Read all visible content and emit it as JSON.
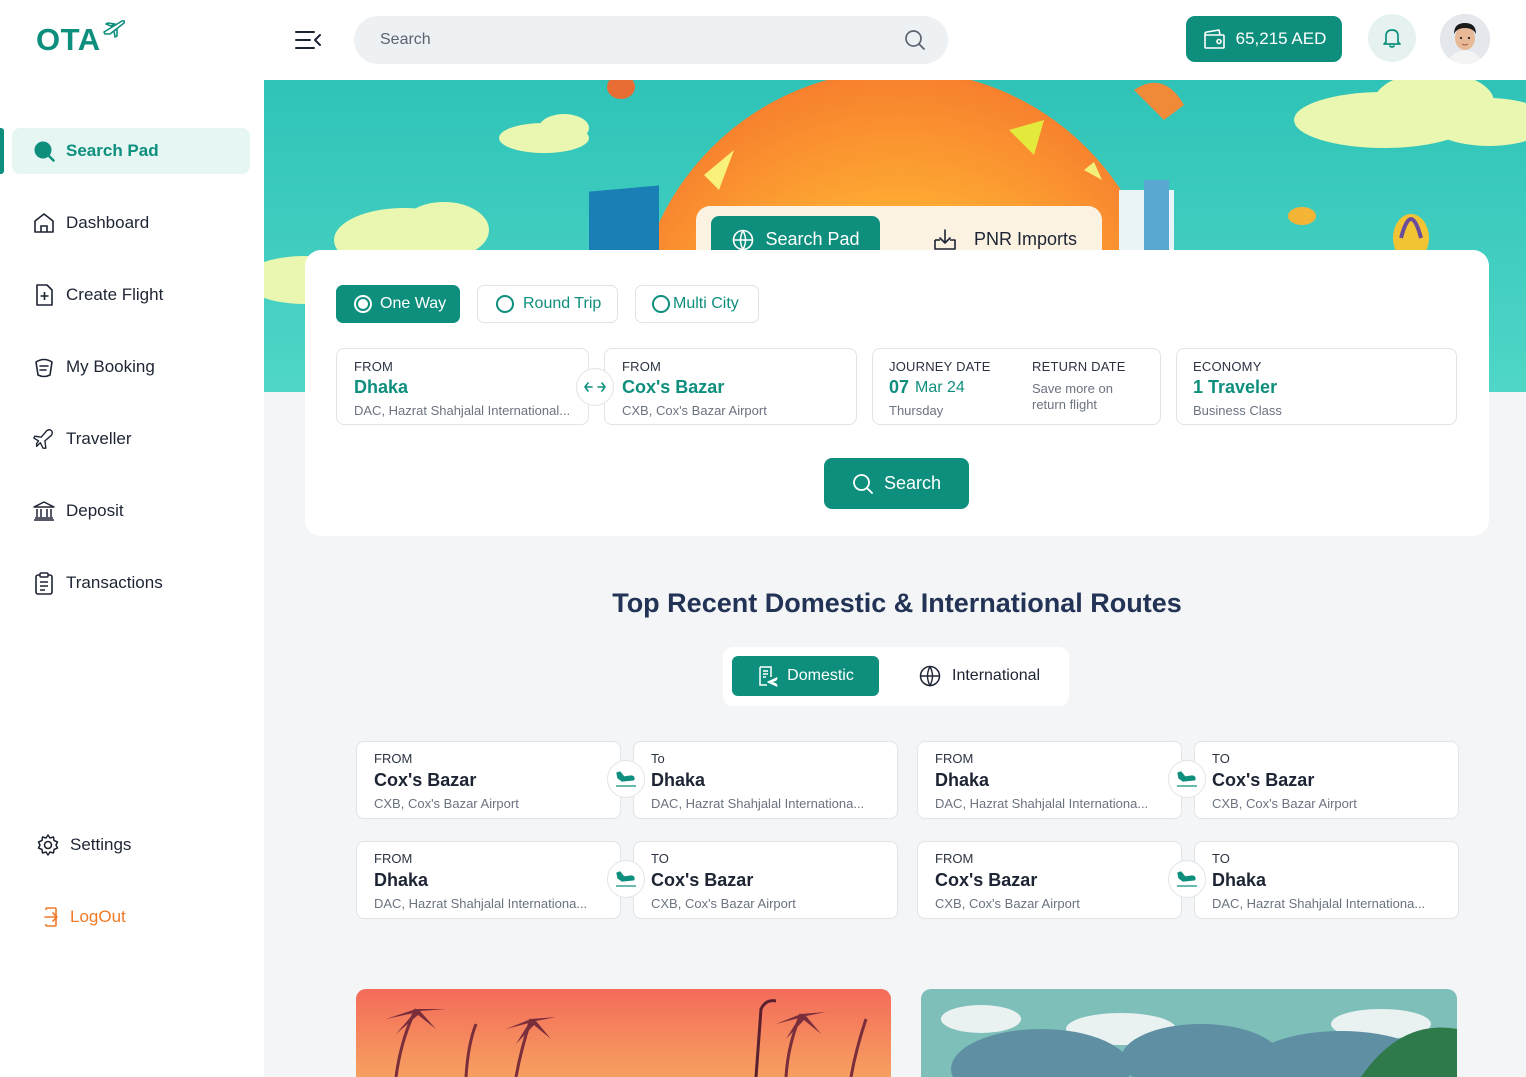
{
  "brand": {
    "logo_text": "OTA"
  },
  "sidebar": {
    "items": [
      {
        "label": "Search Pad",
        "icon": "search-pad-icon",
        "active": true
      },
      {
        "label": "Dashboard",
        "icon": "home-icon"
      },
      {
        "label": "Create Flight",
        "icon": "file-plus-icon"
      },
      {
        "label": "My Booking",
        "icon": "booking-icon"
      },
      {
        "label": "Traveller",
        "icon": "plane-icon"
      },
      {
        "label": "Deposit",
        "icon": "bank-icon"
      },
      {
        "label": "Transactions",
        "icon": "clipboard-icon"
      }
    ],
    "settings_label": "Settings",
    "logout_label": "LogOut"
  },
  "header": {
    "search_placeholder": "Search",
    "wallet_balance": "65,215 AED"
  },
  "search_panel": {
    "tabs": {
      "search_pad": "Search Pad",
      "pnr_imports": "PNR Imports"
    },
    "trip_types": {
      "one_way": "One Way",
      "round_trip": "Round Trip",
      "multi_city": "Multi City"
    },
    "from": {
      "label": "FROM",
      "city": "Dhaka",
      "airport": "DAC, Hazrat Shahjalal International..."
    },
    "to": {
      "label": "FROM",
      "city": "Cox's Bazar",
      "airport": "CXB, Cox's Bazar Airport"
    },
    "journey": {
      "label": "JOURNEY DATE",
      "day": "07",
      "month_year": "Mar 24",
      "weekday": "Thursday"
    },
    "return": {
      "label": "RETURN DATE",
      "line1": "Save more on",
      "line2": "return flight"
    },
    "travel_class": {
      "label": "ECONOMY",
      "travelers": "1 Traveler",
      "cabin": "Business Class"
    },
    "search_button": "Search"
  },
  "routes": {
    "title": "Top Recent Domestic & International Routes",
    "toggle": {
      "domestic": "Domestic",
      "international": "International"
    },
    "cards": [
      {
        "from_label": "FROM",
        "from_city": "Cox's Bazar",
        "from_airport": "CXB, Cox's Bazar Airport",
        "to_label": "To",
        "to_city": "Dhaka",
        "to_airport": "DAC, Hazrat Shahjalal Internationa..."
      },
      {
        "from_label": "FROM",
        "from_city": "Dhaka",
        "from_airport": "DAC, Hazrat Shahjalal Internationa...",
        "to_label": "TO",
        "to_city": "Cox's Bazar",
        "to_airport": "CXB, Cox's Bazar Airport"
      },
      {
        "from_label": "FROM",
        "from_city": "Dhaka",
        "from_airport": "DAC, Hazrat Shahjalal Internationa...",
        "to_label": "TO",
        "to_city": "Cox's Bazar",
        "to_airport": "CXB, Cox's Bazar Airport"
      },
      {
        "from_label": "FROM",
        "from_city": "Cox's Bazar",
        "from_airport": "CXB, Cox's Bazar Airport",
        "to_label": "TO",
        "to_city": "Dhaka",
        "to_airport": "DAC, Hazrat Shahjalal Internationa..."
      }
    ]
  },
  "colors": {
    "accent": "#0e8f7e",
    "logout": "#f07a28",
    "title": "#233356"
  }
}
